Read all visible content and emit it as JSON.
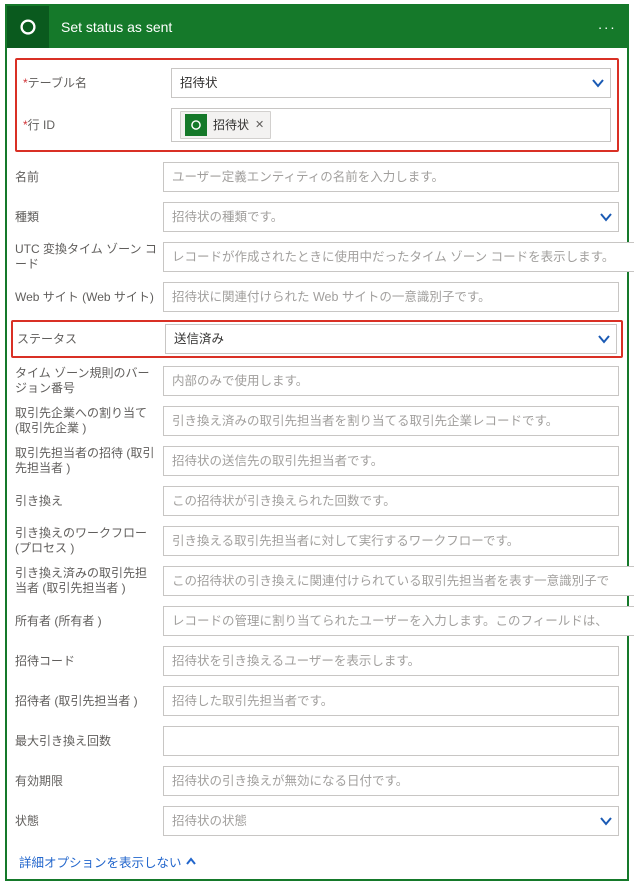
{
  "header": {
    "title": "Set status as sent"
  },
  "fields": {
    "table_name": {
      "label": "テーブル名",
      "value": "招待状"
    },
    "row_id": {
      "label": "行 ID",
      "token": "招待状"
    },
    "name": {
      "label": "名前",
      "placeholder": "ユーザー定義エンティティの名前を入力します。"
    },
    "type": {
      "label": "種類",
      "placeholder": "招待状の種類です。"
    },
    "utc": {
      "label": "UTC 変換タイム ゾーン コード",
      "placeholder": "レコードが作成されたときに使用中だったタイム ゾーン コードを表示します。"
    },
    "website": {
      "label": "Web サイト (Web サイト)",
      "placeholder": "招待状に関連付けられた Web サイトの一意識別子です。"
    },
    "status": {
      "label": "ステータス",
      "value": "送信済み"
    },
    "tz_rule": {
      "label": "タイム ゾーン規則のバージョン番号",
      "placeholder": "内部のみで使用します。"
    },
    "assign_acc": {
      "label": "取引先企業への割り当て (取引先企業 )",
      "placeholder": "引き換え済みの取引先担当者を割り当てる取引先企業レコードです。"
    },
    "invite_con": {
      "label": "取引先担当者の招待 (取引先担当者 )",
      "placeholder": "招待状の送信先の取引先担当者です。"
    },
    "redeem": {
      "label": "引き換え",
      "placeholder": "この招待状が引き換えられた回数です。"
    },
    "wf": {
      "label": "引き換えのワークフロー (プロセス )",
      "placeholder": "引き換える取引先担当者に対して実行するワークフローです。"
    },
    "redeemed_con": {
      "label": "引き換え済みの取引先担当者 (取引先担当者 )",
      "placeholder": "この招待状の引き換えに関連付けられている取引先担当者を表す一意識別子で"
    },
    "owner": {
      "label": "所有者 (所有者 )",
      "placeholder": "レコードの管理に割り当てられたユーザーを入力します。このフィールドは、"
    },
    "code": {
      "label": "招待コード",
      "placeholder": "招待状を引き換えるユーザーを表示します。"
    },
    "inviter": {
      "label": "招待者 (取引先担当者 )",
      "placeholder": "招待した取引先担当者です。"
    },
    "max_redeem": {
      "label": "最大引き換え回数",
      "placeholder": ""
    },
    "expiry": {
      "label": "有効期限",
      "placeholder": "招待状の引き換えが無効になる日付です。"
    },
    "state": {
      "label": "状態",
      "placeholder": "招待状の状態"
    }
  },
  "footer": {
    "show_advanced": "詳細オプションを表示しない"
  }
}
